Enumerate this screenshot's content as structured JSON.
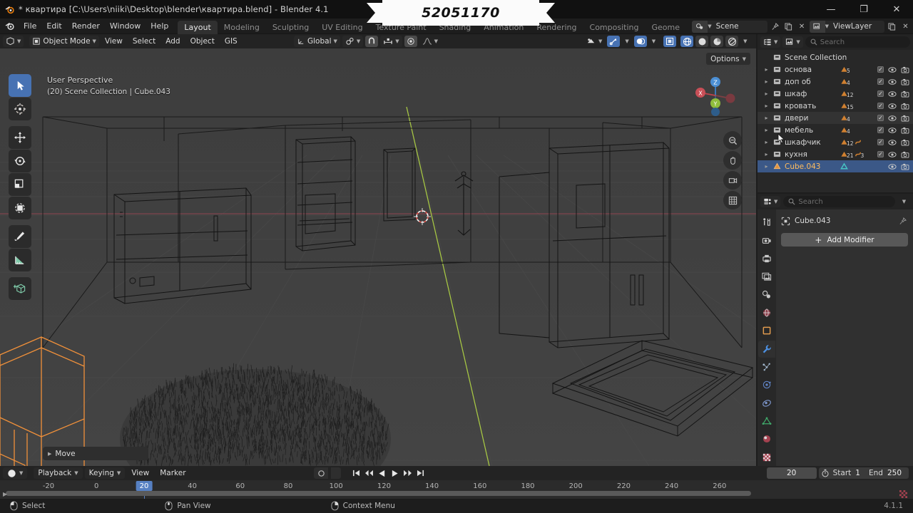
{
  "window": {
    "title": "* квартира [C:\\Users\\niiki\\Desktop\\blender\\квартира.blend] - Blender 4.1",
    "app_icon": "blender-logo-icon",
    "minimize": "—",
    "maximize": "❐",
    "close": "✕"
  },
  "banner": {
    "number": "52051170"
  },
  "topbar": {
    "menus": [
      "File",
      "Edit",
      "Render",
      "Window",
      "Help"
    ],
    "workspaces": [
      {
        "label": "Layout",
        "active": true
      },
      {
        "label": "Modeling",
        "active": false
      },
      {
        "label": "Sculpting",
        "active": false
      },
      {
        "label": "UV Editing",
        "active": false
      },
      {
        "label": "Texture Paint",
        "active": false
      },
      {
        "label": "Shading",
        "active": false
      },
      {
        "label": "Animation",
        "active": false
      },
      {
        "label": "Rendering",
        "active": false
      },
      {
        "label": "Compositing",
        "active": false
      },
      {
        "label": "Geome",
        "active": false
      }
    ],
    "scene": {
      "icon": "scene-icon",
      "name": "Scene",
      "pin": "pin-icon",
      "duplicate": "copy-icon",
      "remove": "✕"
    },
    "view_layer": {
      "icon": "view-layer-icon",
      "name": "ViewLayer",
      "duplicate": "copy-icon",
      "remove": "✕"
    }
  },
  "viewport_header": {
    "editor_type": "editor-type-3dview-icon",
    "mode": "Object Mode",
    "menus": [
      "View",
      "Select",
      "Add",
      "Object",
      "GIS"
    ],
    "transform_orientation": "Global",
    "snap_icon": "magnet-icon",
    "proportional_icon": "proportional-edit-icon",
    "pivot_icon": "pivot-point-icon",
    "falloff_icon": "falloff-curve-icon",
    "visibility_icon": "object-visibility-icon",
    "gizmo_icon": "gizmo-icon",
    "overlays_icon": "overlays-icon",
    "xray_icon": "xray-icon",
    "shading_modes": [
      "wireframe",
      "solid",
      "material-preview",
      "rendered"
    ],
    "shading_active": "wireframe",
    "options_label": "Options"
  },
  "viewport": {
    "overlay_line1": "User Perspective",
    "overlay_line2": "(20) Scene Collection | Cube.043",
    "operator_panel": "Move",
    "tools": [
      {
        "name": "tweak-tool",
        "active": true
      },
      {
        "name": "cursor-tool",
        "active": false
      },
      {
        "name": "move-tool",
        "active": false
      },
      {
        "name": "rotate-tool",
        "active": false
      },
      {
        "name": "scale-tool",
        "active": false
      },
      {
        "name": "transform-tool",
        "active": false
      },
      {
        "name": "annotate-tool",
        "active": false
      },
      {
        "name": "measure-tool",
        "active": false
      },
      {
        "name": "add-cube-tool",
        "active": false
      }
    ],
    "gizmo_axes": [
      "X",
      "Y",
      "Z"
    ],
    "nav_buttons": [
      "zoom-icon",
      "pan-hand-icon",
      "camera-icon",
      "grid-ortho-icon"
    ]
  },
  "outliner": {
    "display_mode_icon": "outliner-display-mode-icon",
    "filter_icon": "outliner-filter-icon",
    "search_placeholder": "Search",
    "root": {
      "label": "Scene Collection",
      "icon": "collection-icon"
    },
    "items": [
      {
        "label": "основа",
        "icon": "collection-icon",
        "badges": [
          {
            "icon": "mesh-data-icon",
            "count": "5"
          }
        ],
        "checkbox": true,
        "eye": true,
        "camera": true,
        "selected": false,
        "highlight": false
      },
      {
        "label": "доп об",
        "icon": "collection-icon",
        "badges": [
          {
            "icon": "mesh-data-icon",
            "count": "4"
          }
        ],
        "checkbox": true,
        "eye": true,
        "camera": true,
        "selected": false,
        "highlight": false
      },
      {
        "label": "шкаф",
        "icon": "collection-icon",
        "badges": [
          {
            "icon": "mesh-data-icon",
            "count": "12"
          }
        ],
        "checkbox": true,
        "eye": true,
        "camera": true,
        "selected": false,
        "highlight": false
      },
      {
        "label": "кровать",
        "icon": "collection-icon",
        "badges": [
          {
            "icon": "mesh-data-icon",
            "count": "15"
          }
        ],
        "checkbox": true,
        "eye": true,
        "camera": true,
        "selected": false,
        "highlight": false
      },
      {
        "label": "двери",
        "icon": "collection-icon",
        "badges": [
          {
            "icon": "mesh-data-icon",
            "count": "4"
          }
        ],
        "checkbox": true,
        "eye": true,
        "camera": true,
        "selected": false,
        "highlight": true
      },
      {
        "label": "мебель",
        "icon": "collection-icon",
        "badges": [
          {
            "icon": "mesh-data-icon",
            "count": "4"
          }
        ],
        "checkbox": true,
        "eye": true,
        "camera": true,
        "selected": false,
        "highlight": false
      },
      {
        "label": "шкафчик",
        "icon": "collection-icon",
        "badges": [
          {
            "icon": "mesh-data-icon",
            "count": "12"
          },
          {
            "icon": "curve-data-icon",
            "count": ""
          }
        ],
        "checkbox": true,
        "eye": true,
        "camera": true,
        "selected": false,
        "highlight": false
      },
      {
        "label": "кухня",
        "icon": "collection-icon",
        "badges": [
          {
            "icon": "mesh-data-icon",
            "count": "21"
          },
          {
            "icon": "curve-data-icon",
            "count": "3"
          }
        ],
        "checkbox": true,
        "eye": true,
        "camera": true,
        "selected": false,
        "highlight": false
      },
      {
        "label": "Cube.043",
        "icon": "mesh-object-icon",
        "badges": [
          {
            "icon": "mesh-data-icon",
            "count": ""
          }
        ],
        "checkbox": false,
        "eye": true,
        "camera": true,
        "selected": true,
        "highlight": false
      }
    ]
  },
  "properties": {
    "editor_icon": "properties-editor-icon",
    "search_placeholder": "Search",
    "tabs": [
      {
        "name": "tool-tab",
        "active": false
      },
      {
        "name": "render-tab",
        "active": false
      },
      {
        "name": "output-tab",
        "active": false
      },
      {
        "name": "view-layer-tab",
        "active": false
      },
      {
        "name": "scene-tab",
        "active": false
      },
      {
        "name": "world-tab",
        "active": false
      },
      {
        "name": "object-tab",
        "active": false
      },
      {
        "name": "modifier-tab",
        "active": true
      },
      {
        "name": "particles-tab",
        "active": false
      },
      {
        "name": "physics-tab",
        "active": false
      },
      {
        "name": "constraints-tab",
        "active": false
      },
      {
        "name": "data-tab",
        "active": false
      },
      {
        "name": "material-tab",
        "active": false
      },
      {
        "name": "texture-tab",
        "active": false
      }
    ],
    "breadcrumb_object": "Cube.043",
    "breadcrumb_icon": "object-icon",
    "pin_icon": "pin-icon",
    "add_modifier_label": "Add Modifier"
  },
  "timeline": {
    "editor_icon": "timeline-editor-icon",
    "menus": [
      "Playback",
      "Keying",
      "View",
      "Marker"
    ],
    "record_icon": "record-keyframe-icon",
    "nav_buttons": [
      "jump-start-icon",
      "prev-keyframe-icon",
      "play-reverse-icon",
      "play-icon",
      "next-keyframe-icon",
      "jump-end-icon"
    ],
    "current_frame": "20",
    "auto_key_icon": "stopwatch-icon",
    "start_label": "Start",
    "start_value": "1",
    "end_label": "End",
    "end_value": "250",
    "ruler_ticks": [
      "-20",
      "0",
      "20",
      "40",
      "60",
      "80",
      "100",
      "120",
      "140",
      "160",
      "180",
      "200",
      "220",
      "240",
      "260"
    ],
    "playhead_frame": "20"
  },
  "statusbar": {
    "items": [
      {
        "icon": "mouse-left-icon",
        "label": "Select"
      },
      {
        "icon": "mouse-middle-icon",
        "label": "Pan View"
      },
      {
        "icon": "mouse-right-icon",
        "label": "Context Menu"
      }
    ],
    "version": "4.1.1"
  },
  "colors": {
    "accent_blue": "#4772b3",
    "selected_row": "#3b5887",
    "selected_text": "#ffbc5e",
    "viewport_bg": "#3d3d3d",
    "header_bg": "#232323",
    "panel_bg": "#303030"
  }
}
